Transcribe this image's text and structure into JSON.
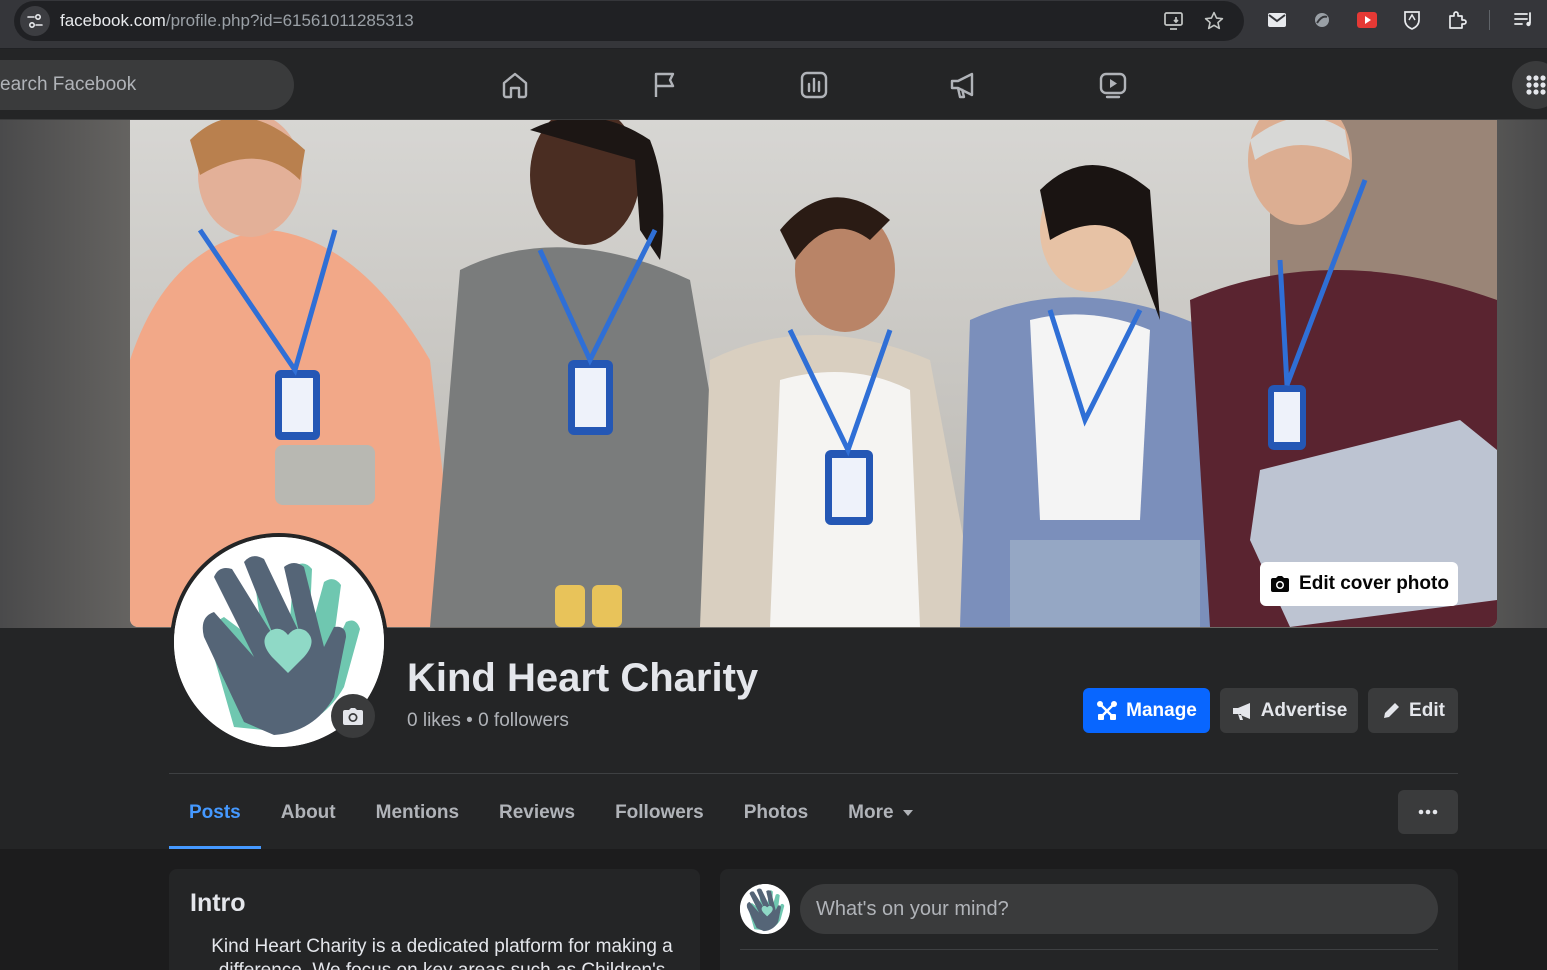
{
  "browser": {
    "url_host": "facebook.com",
    "url_path": "/profile.php?id=61561011285313"
  },
  "fbnav": {
    "search_placeholder": "earch Facebook"
  },
  "page": {
    "title": "Kind Heart Charity",
    "stats": "0 likes • 0 followers",
    "edit_cover_label": "Edit cover photo",
    "manage_label": "Manage",
    "advertise_label": "Advertise",
    "edit_label": "Edit"
  },
  "tabs": [
    {
      "label": "Posts",
      "active": true
    },
    {
      "label": "About"
    },
    {
      "label": "Mentions"
    },
    {
      "label": "Reviews"
    },
    {
      "label": "Followers"
    },
    {
      "label": "Photos"
    },
    {
      "label": "More"
    }
  ],
  "intro": {
    "title": "Intro",
    "text": "Kind Heart Charity is a dedicated platform for making a difference. We focus on key areas such as Children's"
  },
  "composer": {
    "placeholder": "What's on your mind?"
  },
  "colors": {
    "accent": "#0866ff",
    "active_tab": "#4599ff",
    "surface": "#242526",
    "background": "#1c1c1d"
  }
}
